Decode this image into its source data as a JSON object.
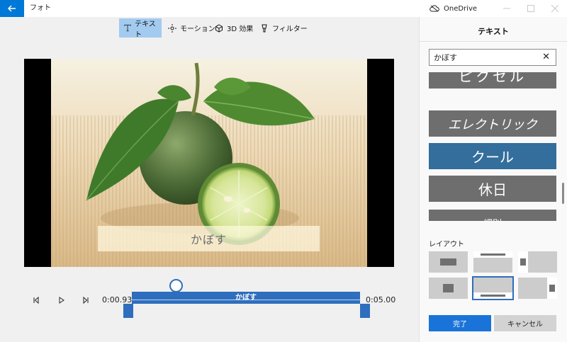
{
  "titlebar": {
    "app_title": "フォト",
    "onedrive_label": "OneDrive",
    "back_icon": "back-arrow-icon"
  },
  "toolbar": {
    "items": [
      {
        "label": "テキスト",
        "icon": "text-icon",
        "active": true
      },
      {
        "label": "モーション",
        "icon": "motion-icon",
        "active": false
      },
      {
        "label": "3D 効果",
        "icon": "3d-effects-icon",
        "active": false
      },
      {
        "label": "フィルター",
        "icon": "filter-icon",
        "active": false
      }
    ]
  },
  "preview": {
    "caption": "かぼす"
  },
  "timeline": {
    "current_time": "0:00.93",
    "end_time": "0:05.00",
    "clip_label": "かぼす"
  },
  "panel": {
    "title": "テキスト",
    "text_value": "かぼす",
    "styles": [
      {
        "label": "ピクセル"
      },
      {
        "label": "エレクトリック"
      },
      {
        "label": "クール"
      },
      {
        "label": "休日"
      },
      {
        "label": "細則"
      }
    ],
    "selected_style": "クール",
    "layout_label": "レイアウト",
    "done_label": "完了",
    "cancel_label": "キャンセル"
  },
  "colors": {
    "accent": "#0078d7",
    "selected_style": "#336e9c",
    "toolbar_active": "#a3cbf0",
    "timeline": "#2e6ebd"
  }
}
